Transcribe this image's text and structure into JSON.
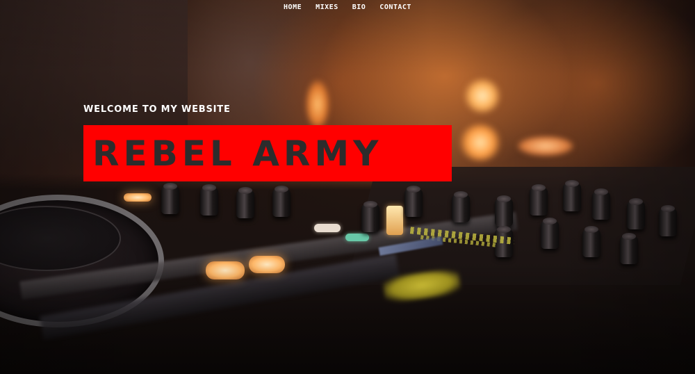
{
  "nav": {
    "items": [
      {
        "label": "HOME"
      },
      {
        "label": "MIXES"
      },
      {
        "label": "BIO"
      },
      {
        "label": "CONTACT"
      }
    ]
  },
  "hero": {
    "kicker": "WELCOME TO MY WEBSITE",
    "title": "REBEL ARMY",
    "background_image": "dj-mixer-photo",
    "title_box_color": "#ff0000",
    "title_text_color": "#2c2c2c",
    "text_color": "#ffffff"
  }
}
